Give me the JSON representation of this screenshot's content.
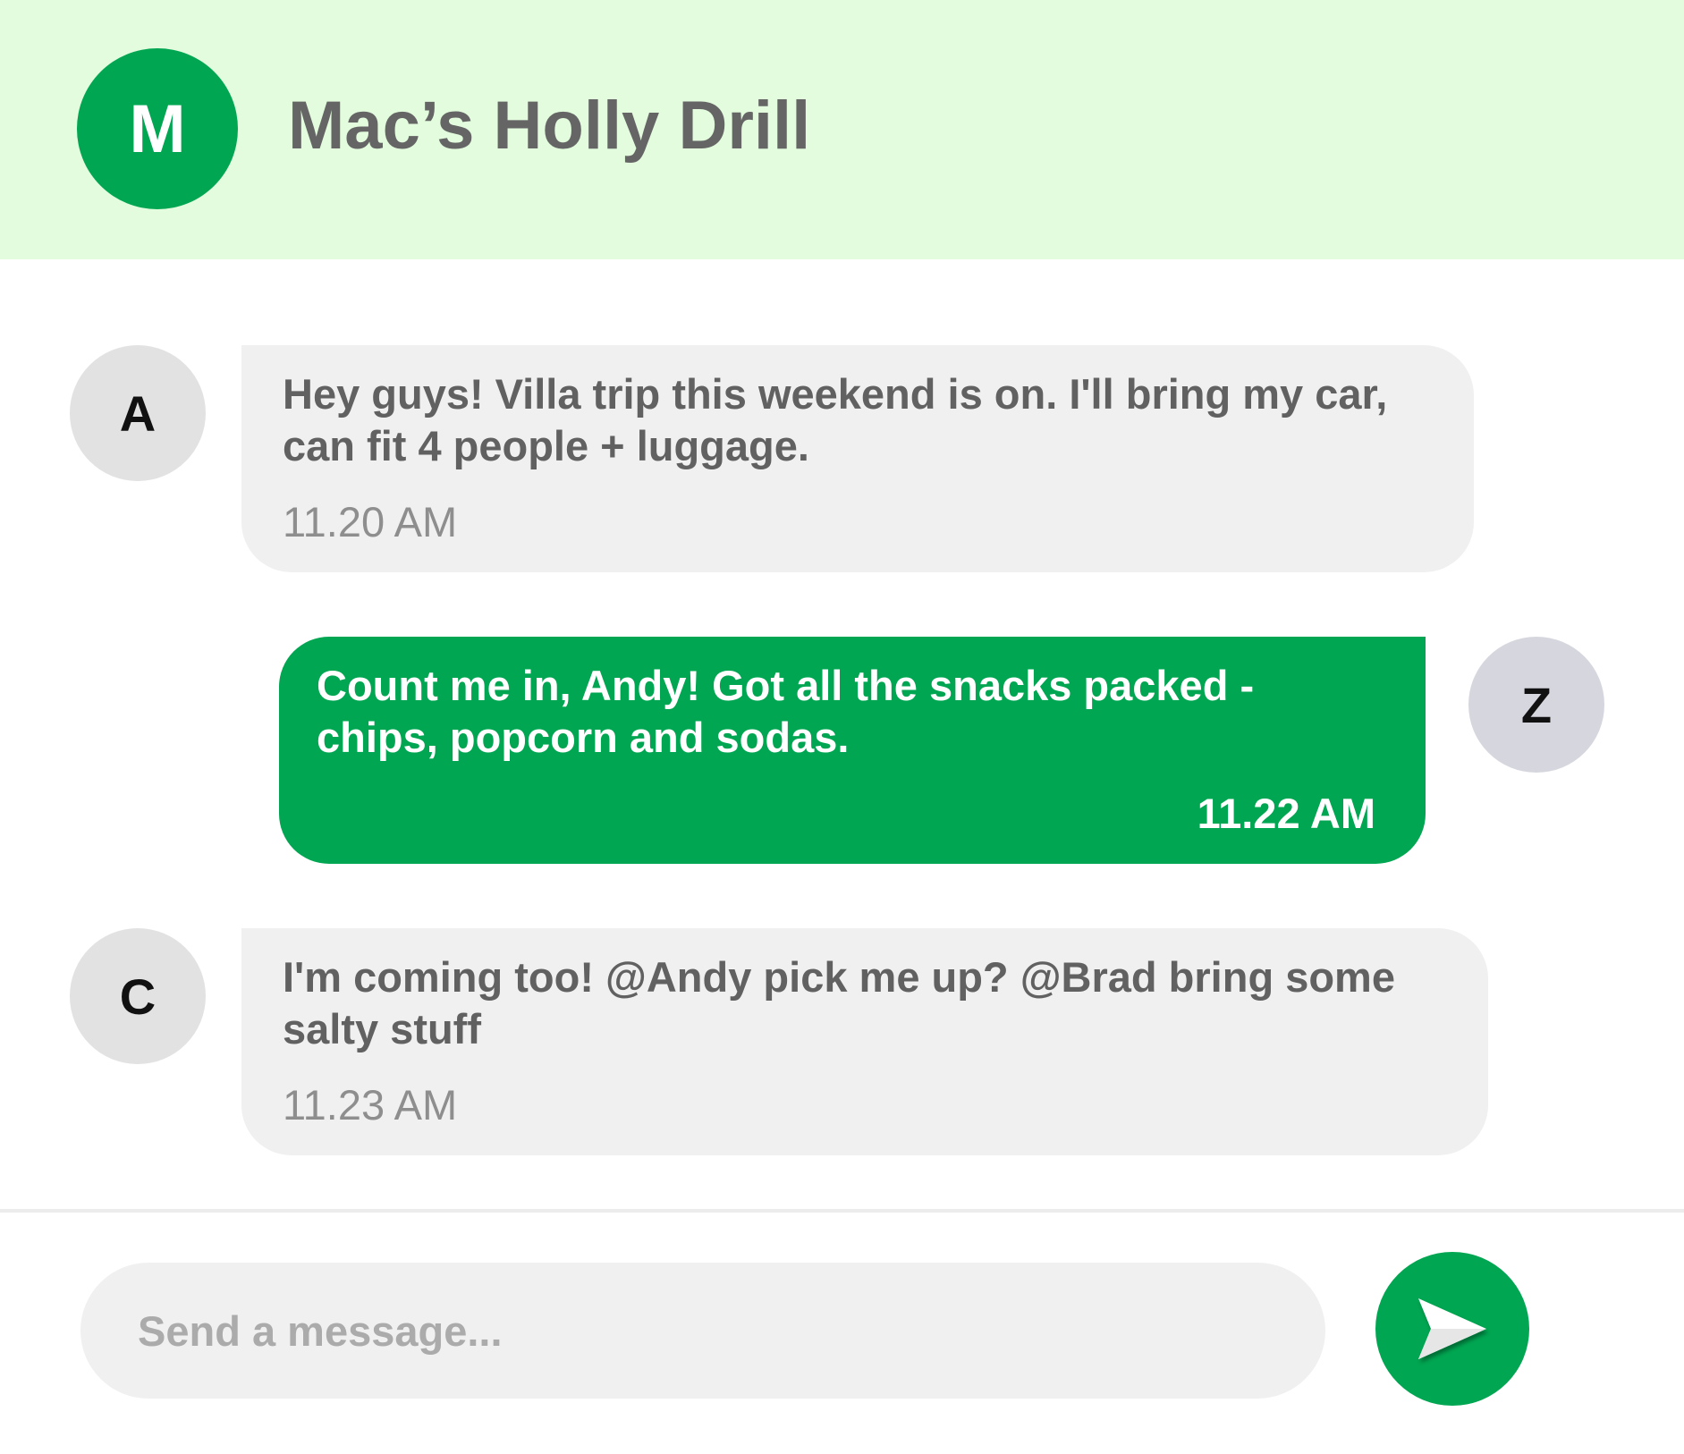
{
  "colors": {
    "accent": "#00a651",
    "header_bg": "#e2fcdd",
    "incoming_bubble": "#f0f0f0",
    "title_text": "#656565"
  },
  "header": {
    "avatar_initial": "M",
    "title": "Mac’s Holly Drill"
  },
  "messages": [
    {
      "avatar": "A",
      "direction": "incoming",
      "text": "Hey guys! Villa trip this weekend is on. I'll bring my car, can fit 4 people + luggage.",
      "time": "11.20 AM"
    },
    {
      "avatar": "Z",
      "direction": "outgoing",
      "text": "Count me in, Andy! Got all the snacks packed - chips, popcorn and sodas.",
      "time": "11.22 AM"
    },
    {
      "avatar": "C",
      "direction": "incoming",
      "text": "I'm coming too! @Andy pick me up? @Brad bring some salty stuff",
      "time": "11.23 AM"
    }
  ],
  "composer": {
    "placeholder": "Send a message...",
    "value": "",
    "send_icon": "paper-plane-icon"
  }
}
